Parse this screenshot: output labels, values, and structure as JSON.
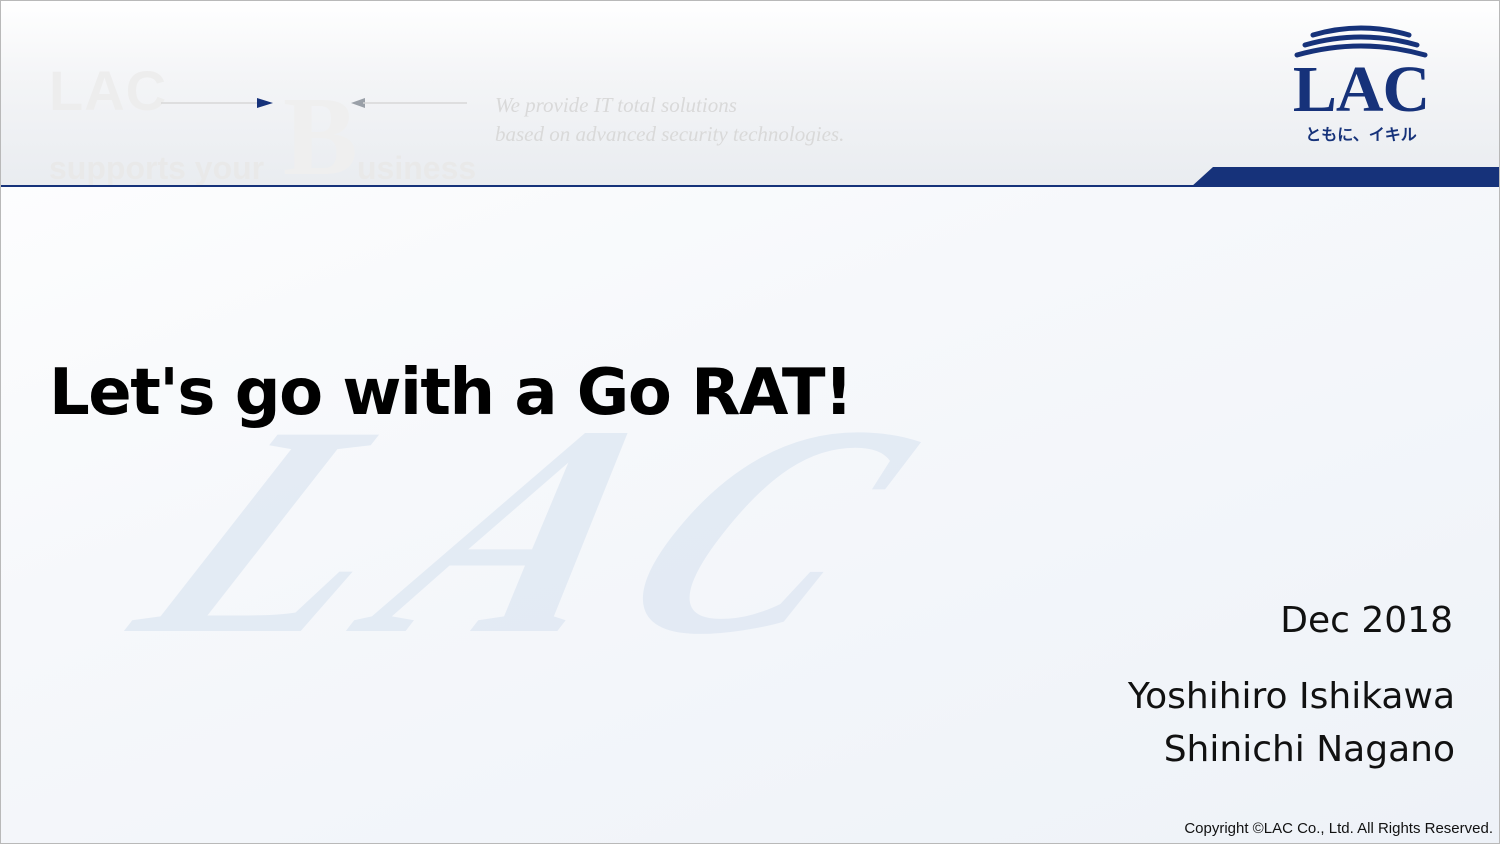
{
  "header": {
    "watermark_brand": "LAC",
    "watermark_supports": "supports your",
    "watermark_b": "B",
    "watermark_usiness": "usiness",
    "watermark_tagline_1": "We provide IT total solutions",
    "watermark_tagline_2": "based on advanced security technologies."
  },
  "logo": {
    "name": "LAC",
    "tagline": "ともに、イキル"
  },
  "background_watermark": "LAC",
  "slide": {
    "title": "Let's go with a Go RAT!",
    "date": "Dec 2018",
    "authors": [
      "Yoshihiro Ishikawa",
      "Shinichi Nagano"
    ]
  },
  "footer": {
    "copyright": "Copyright ©LAC Co., Ltd. All Rights Reserved."
  },
  "colors": {
    "brand_navy": "#16327a",
    "title_text": "#000000",
    "watermark_grey": "#e9e9e9",
    "watermark_blue": "#dfe7f2"
  }
}
